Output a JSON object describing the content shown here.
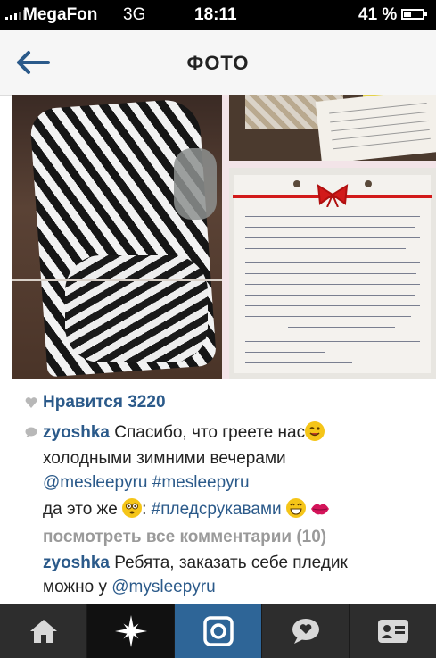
{
  "status_bar": {
    "carrier": "MegaFon",
    "network": "3G",
    "time": "18:11",
    "battery": "41 %",
    "battery_level": 0.41
  },
  "nav": {
    "title": "ФОТО",
    "back_icon": "back-arrow-icon"
  },
  "post": {
    "likes_label": "Нравится 3220",
    "caption_user": "zyoshka",
    "caption_line1": "Спасибо, что греете нас",
    "caption_line2": "холодными зимними вечерами",
    "caption_line3": "@mesleepyru #mesleepyru",
    "caption_line4_pre": "да это же",
    "caption_line4_colon": ":",
    "caption_hashtag": "#пледсрукавами",
    "view_all_comments": "посмотреть все комментарии (10)",
    "comment_user": "zyoshka",
    "comment_line1": "Ребята, заказать себе пледик",
    "comment_line2_pre": "можно у",
    "comment_mention": "@mysleepyru"
  },
  "colors": {
    "accent_blue": "#2b5a8a",
    "tab_active": "#2e6597",
    "tabbar_bg": "#2d2d2d"
  },
  "tabs": [
    {
      "icon": "home-icon"
    },
    {
      "icon": "explore-star-icon"
    },
    {
      "icon": "camera-icon"
    },
    {
      "icon": "news-bubble-icon"
    },
    {
      "icon": "profile-card-icon"
    }
  ]
}
